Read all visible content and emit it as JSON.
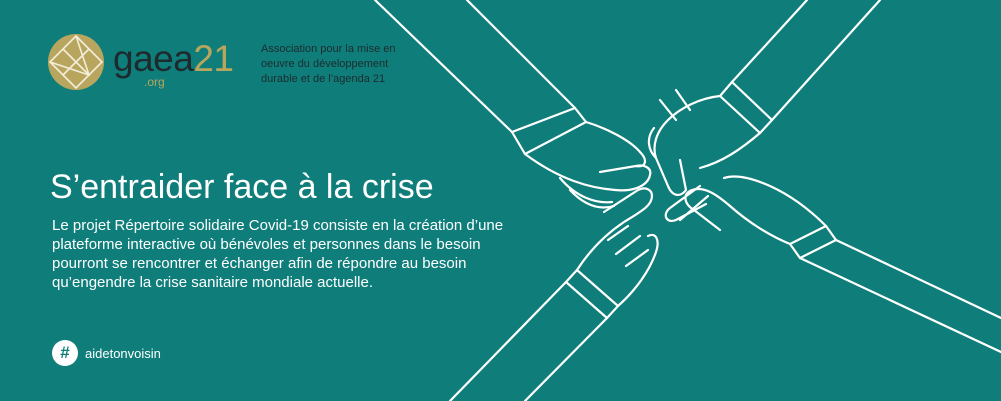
{
  "logo": {
    "name_prefix": "gaea",
    "name_suffix": "21",
    "domain": ".org",
    "tagline": "Association pour la mise en oeuvre du développement durable et de l’agenda 21"
  },
  "headline": "S’entraider face à la crise",
  "description": "Le projet Répertoire solidaire Covid-19 consiste en la création d’une plateforme interactive où bénévoles et personnes dans le besoin pourront se rencontrer et échanger afin de répondre au besoin qu’engendre la crise sanitaire mondiale actuelle.",
  "hashtag": {
    "symbol": "#",
    "text": "aidetonvoisin"
  },
  "colors": {
    "background": "#0f7e7b",
    "logo_gold": "#b9a65e",
    "logo_dark": "#1d2a2e",
    "text": "#ffffff"
  },
  "illustration": {
    "icon": "four-hands-reaching-to-center",
    "style": "white-outline"
  }
}
